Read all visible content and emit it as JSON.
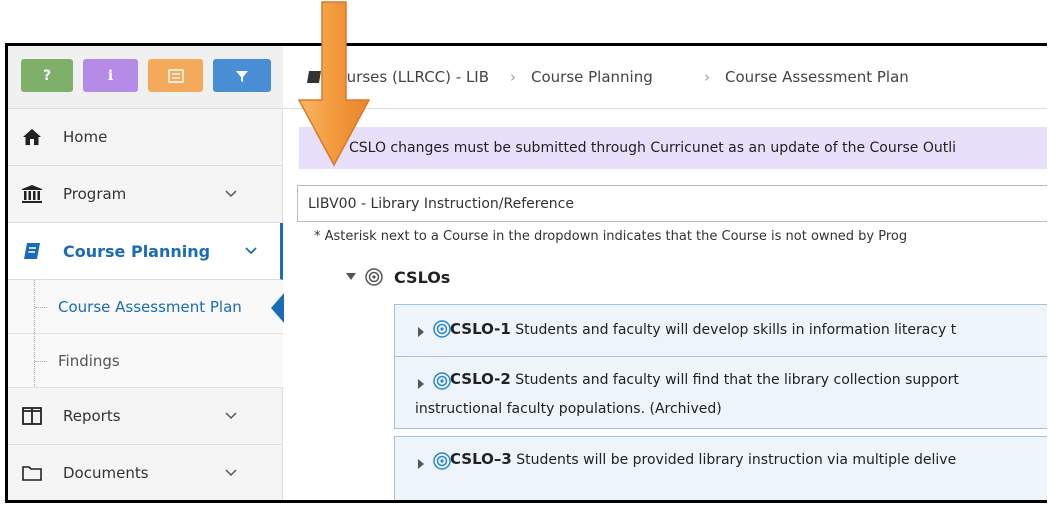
{
  "toolbar": {
    "help_label": "?",
    "info_label": "i",
    "colors": {
      "help": "#7fb069",
      "info": "#b48ce8",
      "list": "#f5a95a",
      "filter": "#4a8fd6"
    }
  },
  "breadcrumb": {
    "items": [
      "Courses (LLRCC) - LIB",
      "Course Planning",
      "Course Assessment Plan"
    ]
  },
  "sidebar": {
    "items": [
      {
        "label": "Home",
        "icon": "home-icon"
      },
      {
        "label": "Program",
        "icon": "institution-icon"
      },
      {
        "label": "Course Planning",
        "icon": "book-icon",
        "active": true
      },
      {
        "label": "Reports",
        "icon": "columns-icon"
      },
      {
        "label": "Documents",
        "icon": "folder-icon"
      }
    ],
    "sub_items": [
      {
        "label": "Course Assessment Plan",
        "active": true
      },
      {
        "label": "Findings"
      }
    ],
    "accent": "#1a6bb8"
  },
  "notice": {
    "text": "CSLO changes must be submitted through Curricunet as an update of the Course Outli"
  },
  "course_select": {
    "value": "LIBV00 - Library Instruction/Reference"
  },
  "asterisk_note": "* Asterisk next to a Course in the dropdown indicates that the Course is not owned by Prog",
  "cslos": {
    "heading": "CSLOs",
    "items": [
      {
        "code": "CSLO-1",
        "text": "Students and faculty will develop skills in information literacy t"
      },
      {
        "code": "CSLO-2",
        "text": "Students and faculty will find that the library collection support",
        "text2": "instructional faculty populations. (Archived)"
      },
      {
        "code": "CSLO–3",
        "text": "Students will be provided library instruction via multiple delive"
      }
    ]
  },
  "annotation": {
    "arrow_color": "#f29a3c"
  }
}
